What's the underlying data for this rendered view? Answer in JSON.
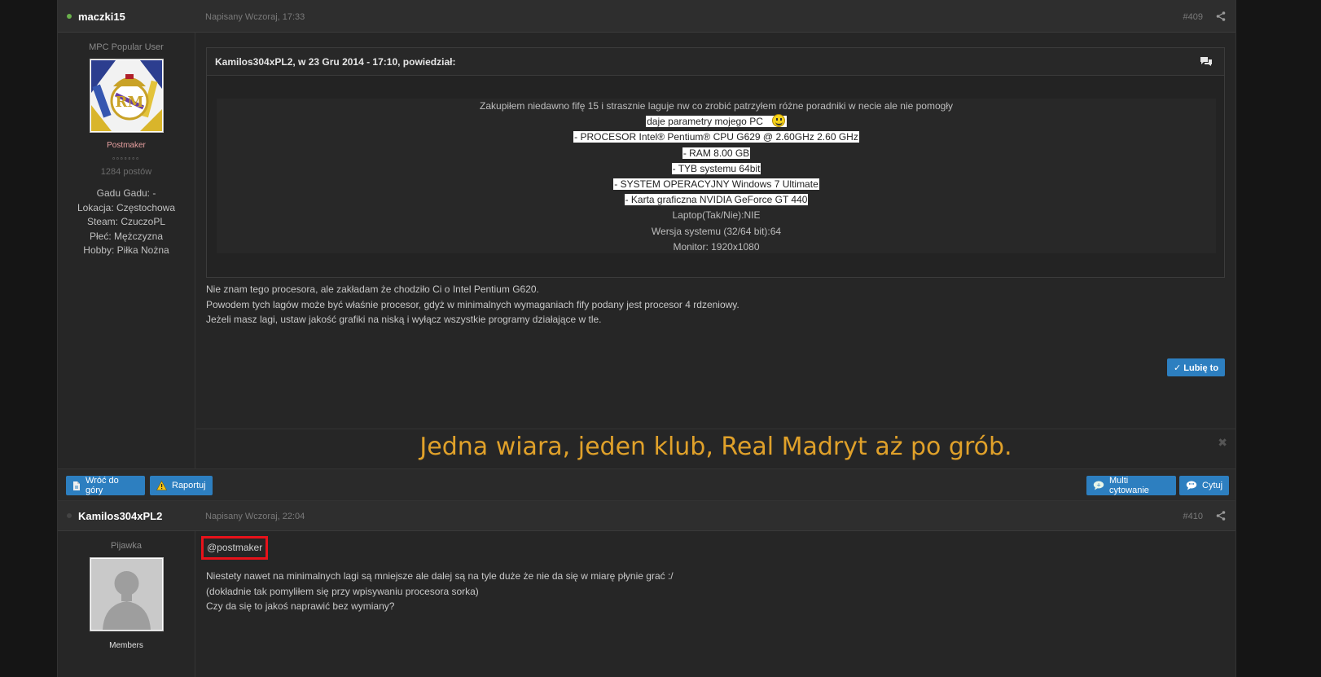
{
  "post1": {
    "author": "maczki15",
    "online_color": "#6ab04c",
    "date": "Napisany Wczoraj, 17:33",
    "number": "#409",
    "user_title": "MPC Popular User",
    "rank": "Postmaker",
    "rank_color": "#e8a0a0",
    "pips": "▫▫▫▫▫▫▫",
    "post_count": "1284 postów",
    "info": {
      "gadu": "Gadu Gadu: -",
      "lokacja": "Lokacja: Częstochowa",
      "steam": "Steam: CzuczoPL",
      "plec": "Płeć: Mężczyzna",
      "hobby": "Hobby: Piłka Nożna"
    },
    "quote_header": "Kamilos304xPL2, w 23 Gru 2014 - 17:10, powiedział:",
    "quote_lines": {
      "l1": "Zakupiłem niedawno fifę 15 i strasznie laguje nw co zrobić patrzyłem różne poradniki w necie ale nie pomogły",
      "l2": "daje parametry mojego PC",
      "l3": "- PROCESOR Intel® Pentium® CPU G629 @ 2.60GHz 2.60 GHz",
      "l4": "- RAM 8.00 GB",
      "l5": "- TYB systemu 64bit",
      "l6": "- SYSTEM OPERACYJNY Windows 7 Ultimate",
      "l7": "- Karta graficzna NVIDIA GeForce GT 440",
      "l8": "Laptop(Tak/Nie):NIE",
      "l9": "Wersja systemu (32/64 bit):64",
      "l10": "Monitor: 1920x1080"
    },
    "body": {
      "p1": "Nie znam tego procesora, ale zakładam że chodziło Ci o Intel Pentium G620.",
      "p2": "Powodem tych lagów może być właśnie procesor, gdyż w minimalnych wymaganiach fify podany jest procesor 4 rdzeniowy.",
      "p3": "Jeżeli masz lagi, ustaw jakość grafiki na niską i wyłącz wszystkie programy działające w tle."
    },
    "like_label": "✓ Lubię to",
    "signature": "Jedna wiara, jeden klub, Real Madryt aż po grób."
  },
  "footer": {
    "back_top": "Wróć do góry",
    "report": "Raportuj",
    "multi_quote": "Multi cytowanie",
    "quote": "Cytuj"
  },
  "post2": {
    "author": "Kamilos304xPL2",
    "online_color": "#444444",
    "date": "Napisany Wczoraj, 22:04",
    "number": "#410",
    "user_title": "Pijawka",
    "rank": "Members",
    "mention": "@postmaker",
    "body": {
      "p1": "Niestety nawet na minimalnych lagi są mniejsze ale dalej są na tyle duże że nie da się w miarę płynie grać :/",
      "p2": "(dokładnie tak pomyliłem się przy wpisywaniu procesora sorka)",
      "p3": "Czy da się to jakoś naprawić bez wymiany?"
    }
  },
  "colors": {
    "button_blue": "#2d7fc0",
    "signature_gold": "#e0a12a",
    "highlight_red": "#e8121a"
  }
}
